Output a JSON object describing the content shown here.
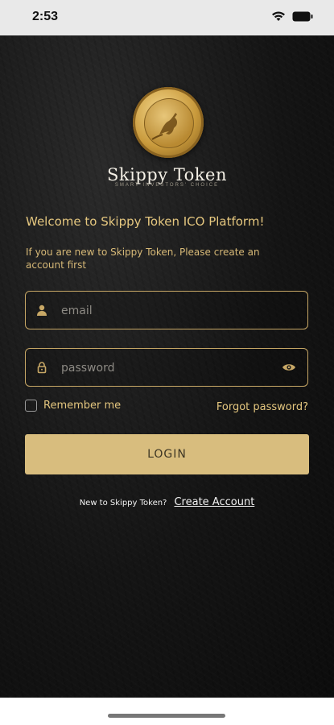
{
  "status_bar": {
    "time": "2:53"
  },
  "brand": {
    "title": "Skippy Token",
    "subtitle": "SMART INVESTORS' CHOICE"
  },
  "welcome_text": "Welcome to Skippy Token ICO Platform!",
  "intro_text": "If you are new to Skippy Token, Please create an account first",
  "email_field": {
    "placeholder": "email",
    "value": ""
  },
  "password_field": {
    "placeholder": "password",
    "value": ""
  },
  "remember_label": "Remember me",
  "forgot_label": "Forgot password?",
  "login_label": "LOGIN",
  "signup": {
    "question": "New to Skippy Token?",
    "link": "Create Account"
  },
  "colors": {
    "accent": "#d8bd7e",
    "gold_text": "#e5c77f",
    "background": "#141414"
  },
  "icons": [
    "wifi-icon",
    "battery-icon",
    "user-icon",
    "lock-icon",
    "eye-icon",
    "coin-logo-icon"
  ]
}
